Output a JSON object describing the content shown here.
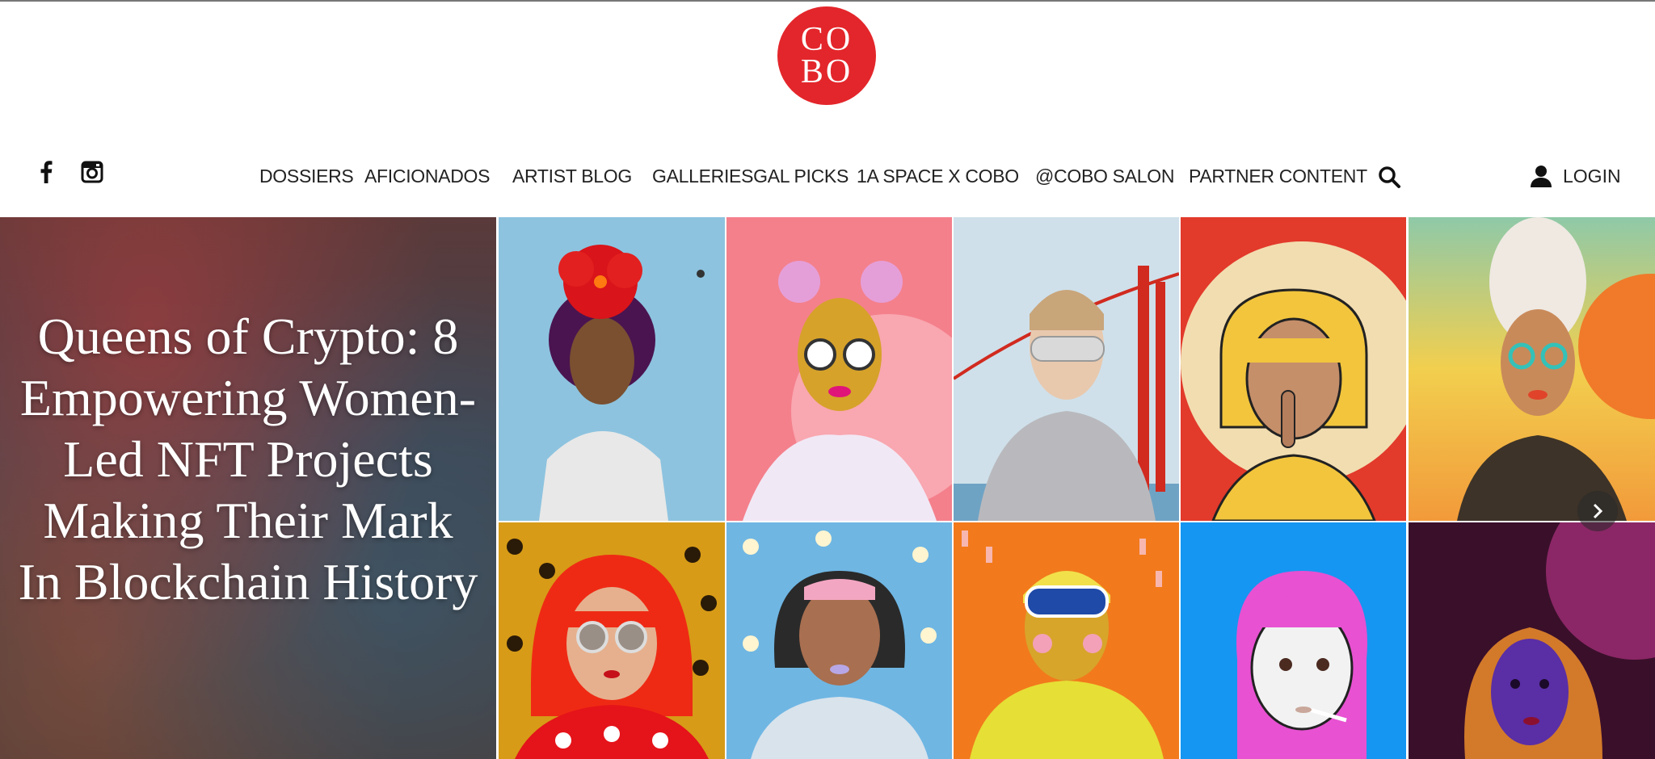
{
  "brand": {
    "logo_line1": "CO",
    "logo_line2": "BO",
    "color": "#e3262b"
  },
  "social": [
    {
      "icon": "facebook-icon"
    },
    {
      "icon": "instagram-icon"
    }
  ],
  "nav": {
    "items": [
      {
        "label": "DOSSIERS"
      },
      {
        "label": "AFICIONADOS"
      },
      {
        "label": "ARTIST BLOG"
      },
      {
        "label": "GALLERIESGAL PICKS"
      },
      {
        "label": "1A SPACE X COBO"
      },
      {
        "label": "@COBO SALON"
      },
      {
        "label": "PARTNER CONTENT"
      }
    ],
    "search_icon": "search-icon",
    "login_label": "LOGIN",
    "login_icon": "user-icon"
  },
  "hero": {
    "title": "Queens of Crypto: 8 Empowering Women-Led NFT Projects Making Their Mark In Blockchain History"
  },
  "carousel": {
    "next_icon": "chevron-right-icon"
  }
}
